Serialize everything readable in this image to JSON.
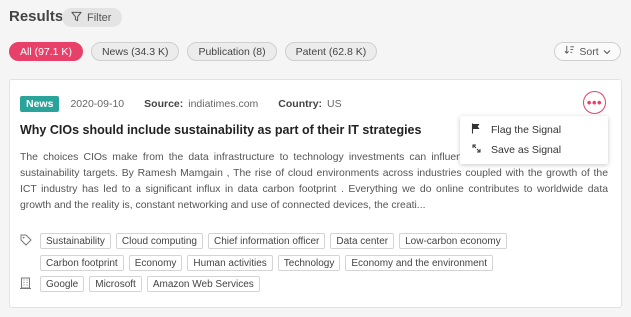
{
  "header": {
    "title": "Results",
    "filter_label": "Filter"
  },
  "chips": [
    {
      "label": "All (97.1 K)",
      "active": true
    },
    {
      "label": "News (34.3 K)"
    },
    {
      "label": "Publication (8)"
    },
    {
      "label": "Patent (62.8 K)"
    }
  ],
  "sort": {
    "label": "Sort"
  },
  "card": {
    "badge": "News",
    "date": "2020-09-10",
    "source_label": "Source:",
    "source_value": "indiatimes.com",
    "country_label": "Country:",
    "country_value": "US",
    "headline": "Why CIOs should include sustainability as part of their IT strategies",
    "description": "The choices CIOs make from the data infrastructure to technology investments can influen... organisation and accelerate sustainability targets. By Ramesh Mamgain , The rise of cloud environments across industries coupled with the growth of the ICT industry has led to a significant influx in data carbon footprint . Everything we do online contributes to worldwide data growth and the reality is, constant networking and use of connected devices, the creati...",
    "topic_tags_row1": [
      "Sustainability",
      "Cloud computing",
      "Chief information officer",
      "Data center",
      "Low-carbon economy"
    ],
    "topic_tags_row2": [
      "Carbon footprint",
      "Economy",
      "Human activities",
      "Technology",
      "Economy and the environment"
    ],
    "org_tags": [
      "Google",
      "Microsoft",
      "Amazon Web Services"
    ]
  },
  "menu": {
    "flag_label": "Flag the Signal",
    "save_label": "Save as Signal"
  },
  "icons": {
    "filter": "filter-icon",
    "sort": "sort-icon",
    "more": "more-horizontal-icon",
    "flag": "flag-icon",
    "save": "save-signal-icon",
    "tag": "tag-icon",
    "organization": "building-icon"
  },
  "colors": {
    "accent": "#e7416a",
    "news_badge": "#2aa39a"
  }
}
